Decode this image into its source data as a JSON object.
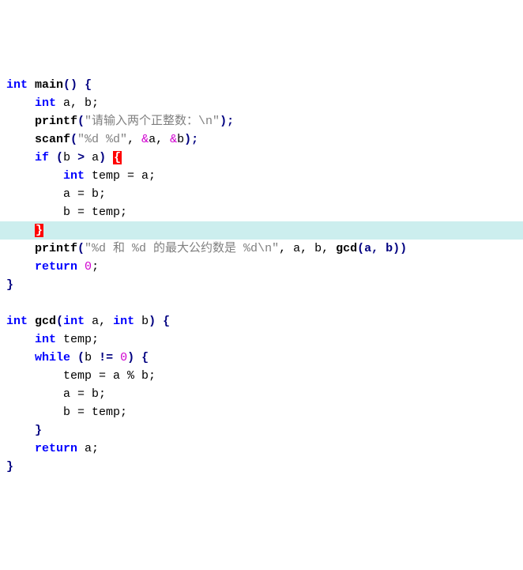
{
  "code": {
    "l1": {
      "kw_int": "int",
      "main": "main",
      "paren": "()",
      "brace": " {"
    },
    "l2": {
      "indent": "    ",
      "kw_int": "int",
      "vars": " a, b;"
    },
    "l3": {
      "indent": "    ",
      "fn": "printf",
      "paren_o": "(",
      "str": "\"请输入两个正整数：\\n\"",
      "paren_c": ");"
    },
    "l4": {
      "indent": "    ",
      "fn": "scanf",
      "paren_o": "(",
      "str": "\"%d %d\"",
      "comma": ", ",
      "amp1": "&",
      "a": "a",
      "comma2": ", ",
      "amp2": "&",
      "b": "b",
      "paren_c": ");"
    },
    "l5": {
      "indent": "    ",
      "kw_if": "if",
      "sp": " ",
      "paren_o": "(",
      "b": "b ",
      "op": ">",
      "a": " a",
      "paren_c": ") ",
      "brace": "{"
    },
    "l6": {
      "indent": "        ",
      "kw_int": "int",
      "rest": " temp = a;"
    },
    "l7": {
      "indent": "        ",
      "rest": "a = b;"
    },
    "l8": {
      "indent": "        ",
      "rest": "b = temp;"
    },
    "l9": {
      "indent": "    ",
      "brace": "}"
    },
    "l10": {
      "indent": "    ",
      "fn": "printf",
      "paren_o": "(",
      "str": "\"%d 和 %d 的最大公约数是 %d\\n\"",
      "comma": ", a, b, ",
      "gcd": "gcd",
      "args": "(a, b)",
      "paren_c": ")"
    },
    "l11": {
      "indent": "    ",
      "kw_return": "return",
      "sp": " ",
      "zero": "0",
      "semi": ";"
    },
    "l12": {
      "brace": "}"
    },
    "l14": {
      "kw_int": "int",
      "sp": " ",
      "gcd": "gcd",
      "paren_o": "(",
      "kw_int2": "int",
      "a": " a",
      "comma": ", ",
      "kw_int3": "int",
      "b": " b",
      "paren_c": ") {"
    },
    "l15": {
      "indent": "    ",
      "kw_int": "int",
      "rest": " temp;"
    },
    "l16": {
      "indent": "    ",
      "kw_while": "while",
      "sp": " ",
      "paren_o": "(",
      "b": "b ",
      "op": "!=",
      "sp2": " ",
      "zero": "0",
      "paren_c": ") {"
    },
    "l17": {
      "indent": "        ",
      "rest": "temp = a % b;"
    },
    "l18": {
      "indent": "        ",
      "rest": "a = b;"
    },
    "l19": {
      "indent": "        ",
      "rest": "b = temp;"
    },
    "l20": {
      "indent": "    ",
      "brace": "}"
    },
    "l21": {
      "indent": "    ",
      "kw_return": "return",
      "rest": " a;"
    },
    "l22": {
      "brace": "}"
    }
  }
}
